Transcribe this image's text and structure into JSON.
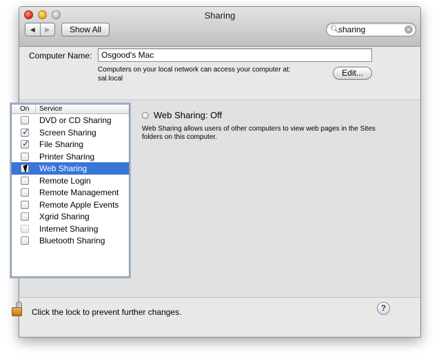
{
  "window": {
    "title": "Sharing"
  },
  "toolbar": {
    "back_glyph": "◀",
    "forward_glyph": "▶",
    "show_all_label": "Show All",
    "search_value": "sharing"
  },
  "computer_name": {
    "label": "Computer Name:",
    "value": "Osgood's Mac",
    "description_line1": "Computers on your local network can access your computer at:",
    "description_line2": "sal.local",
    "edit_label": "Edit..."
  },
  "services": {
    "header_on": "On",
    "header_service": "Service",
    "items": [
      {
        "name": "DVD or CD Sharing",
        "checked": false,
        "selected": false
      },
      {
        "name": "Screen Sharing",
        "checked": true,
        "selected": false
      },
      {
        "name": "File Sharing",
        "checked": true,
        "selected": false
      },
      {
        "name": "Printer Sharing",
        "checked": false,
        "selected": false
      },
      {
        "name": "Web Sharing",
        "checked": false,
        "selected": true
      },
      {
        "name": "Remote Login",
        "checked": false,
        "selected": false
      },
      {
        "name": "Remote Management",
        "checked": false,
        "selected": false
      },
      {
        "name": "Remote Apple Events",
        "checked": false,
        "selected": false
      },
      {
        "name": "Xgrid Sharing",
        "checked": false,
        "selected": false
      },
      {
        "name": "Internet Sharing",
        "checked": false,
        "selected": false,
        "dimmed": true
      },
      {
        "name": "Bluetooth Sharing",
        "checked": false,
        "selected": false
      }
    ]
  },
  "detail": {
    "status_title": "Web Sharing: Off",
    "description_line1": "Web Sharing allows users of other computers to view web pages in the Sites",
    "description_line2": "folders on this computer."
  },
  "footer": {
    "lock_text": "Click the lock to prevent further changes.",
    "help_glyph": "?"
  },
  "colors": {
    "selection": "#3875d7",
    "window_bg": "#e8e8e8"
  }
}
